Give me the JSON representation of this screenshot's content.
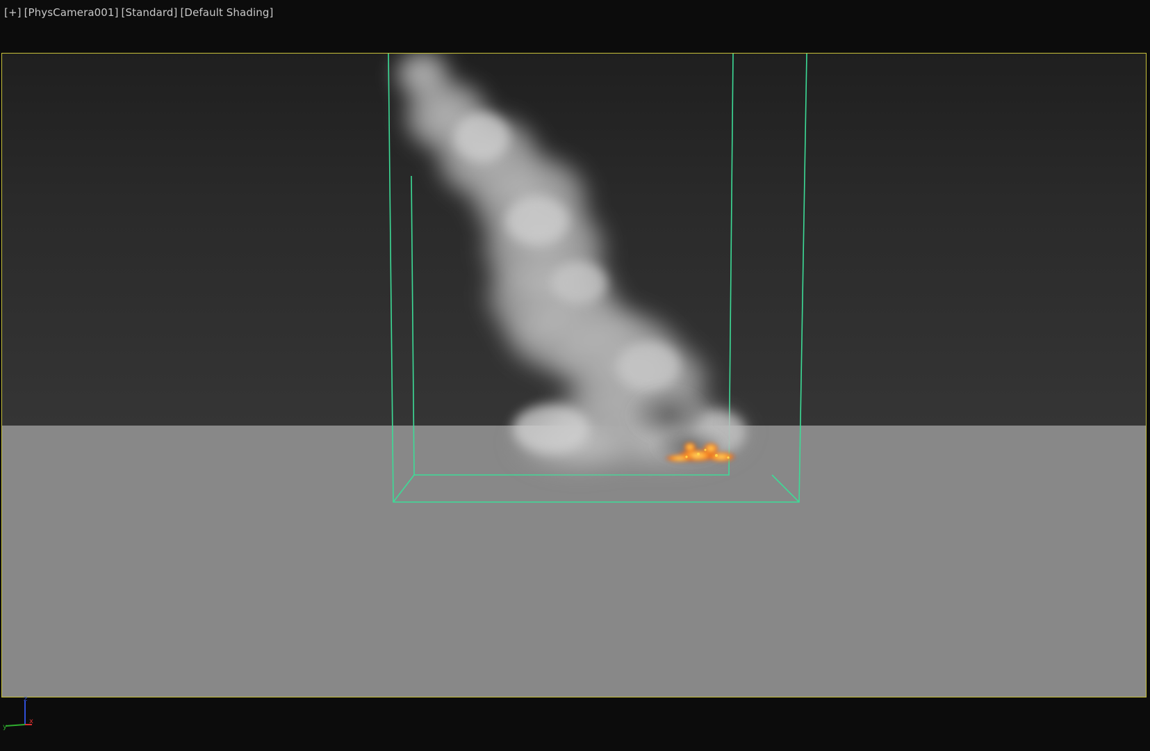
{
  "viewport": {
    "labels": [
      "[+]",
      "[PhysCamera001]",
      "[Standard]",
      "[Default Shading]"
    ]
  },
  "axes": {
    "z": "z",
    "x": "x",
    "y": "y"
  },
  "colors": {
    "frame": "#c9c23a",
    "bbox": "#3ddc97",
    "sky": "#2a2a2a",
    "ground": "#888888",
    "smoke": "#bdbdbd",
    "fire": "#ff8a1c",
    "axis_x": "#d93030",
    "axis_y": "#2fae2f",
    "axis_z": "#3050d9"
  },
  "icons": [
    "axis-gizmo-icon"
  ]
}
